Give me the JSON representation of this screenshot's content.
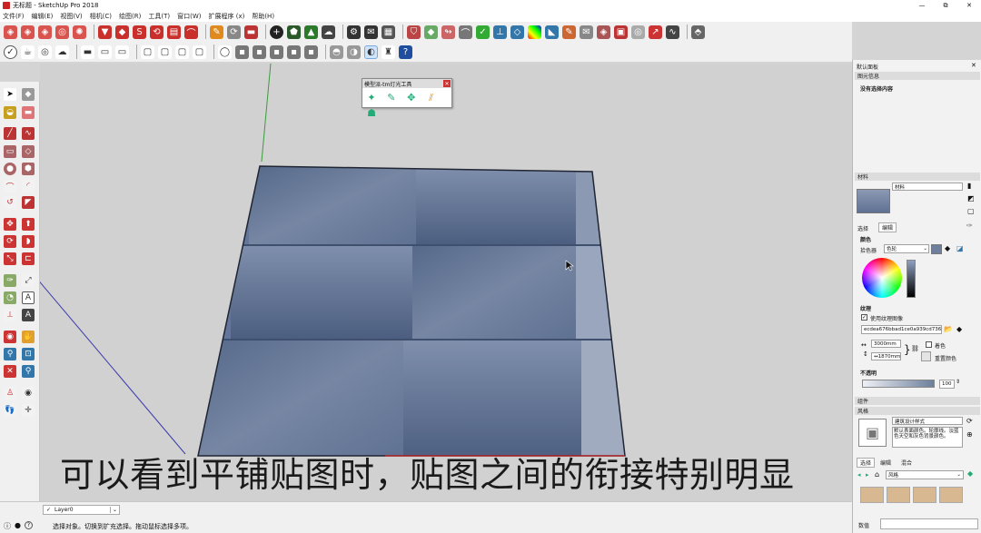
{
  "window": {
    "title": "无标题 - SketchUp Pro 2018",
    "min_icon": "minimize-icon",
    "max_icon": "maximize-icon",
    "close_icon": "close-icon",
    "min_glyph": "—",
    "max_glyph": "⧉",
    "close_glyph": "✕"
  },
  "menu": [
    "文件(F)",
    "编辑(E)",
    "视图(V)",
    "相机(C)",
    "绘图(R)",
    "工具(T)",
    "窗口(W)",
    "扩展程序 (x)",
    "帮助(H)"
  ],
  "plugin_toolbar": {
    "title": "模型派-tm灯光工具",
    "close": "✕"
  },
  "caption": "可以看到平铺贴图时，贴图之间的衔接特别明显",
  "status": {
    "layer": "Layer0",
    "hint": "选择对象。切换到扩充选择。拖动鼠标选择多项。",
    "measure_label": "数值"
  },
  "tray": {
    "title": "默认面板",
    "entity_info": {
      "header": "图元信息",
      "text": "没有选择内容"
    },
    "materials": {
      "header": "材料",
      "name": "材料",
      "tab_select": "选择",
      "tab_edit": "编辑",
      "color_label": "颜色",
      "picker_label": "拾色器",
      "picker_value": "色轮",
      "texture_label": "纹理",
      "use_texture": "使用纹理图像",
      "texture_file": "ecdea676bbad1ce0a939cd736",
      "width": "3000mm",
      "height": "1870mm",
      "colorize": "着色",
      "reset_color": "重置颜色",
      "opacity_label": "不透明",
      "opacity_value": "100"
    },
    "components": {
      "header": "组件"
    },
    "styles": {
      "header": "风格",
      "style_name": "建筑设计样式",
      "style_desc": "默认表面颜色。轮廓线。淡蓝色天空和灰色背景颜色。",
      "tab_select": "选择",
      "tab_edit": "编辑",
      "tab_mix": "混合",
      "dropdown": "风格"
    }
  },
  "colors": {
    "accent_blue": "#2f5fd0",
    "texture_blue": "#6d7f9c",
    "selection_red": "#cc2222"
  }
}
